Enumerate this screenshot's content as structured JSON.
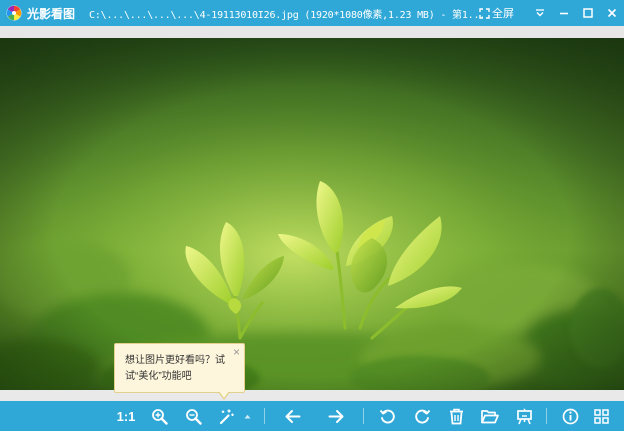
{
  "titlebar": {
    "app_name": "光影看图",
    "file_info": "C:\\...\\...\\...\\...\\4-19113010I26.jpg (1920*1080像素,1.23 MB) - 第1...",
    "fullscreen_label": "全屏",
    "colors": {
      "bar": "#2fa8d8",
      "text": "#ffffff"
    }
  },
  "tooltip": {
    "line1": "想让图片更好看吗？试",
    "line2": "试“美化”功能吧",
    "close_glyph": "×"
  },
  "toolbar": {
    "actual_size_label": "1:1",
    "icons": [
      "zoom-in-icon",
      "zoom-out-icon",
      "magic-wand-icon",
      "caret-up-icon",
      "arrow-left-icon",
      "arrow-right-icon",
      "rotate-left-icon",
      "rotate-right-icon",
      "trash-icon",
      "folder-open-icon",
      "easel-icon",
      "info-icon",
      "grid-icon"
    ]
  }
}
